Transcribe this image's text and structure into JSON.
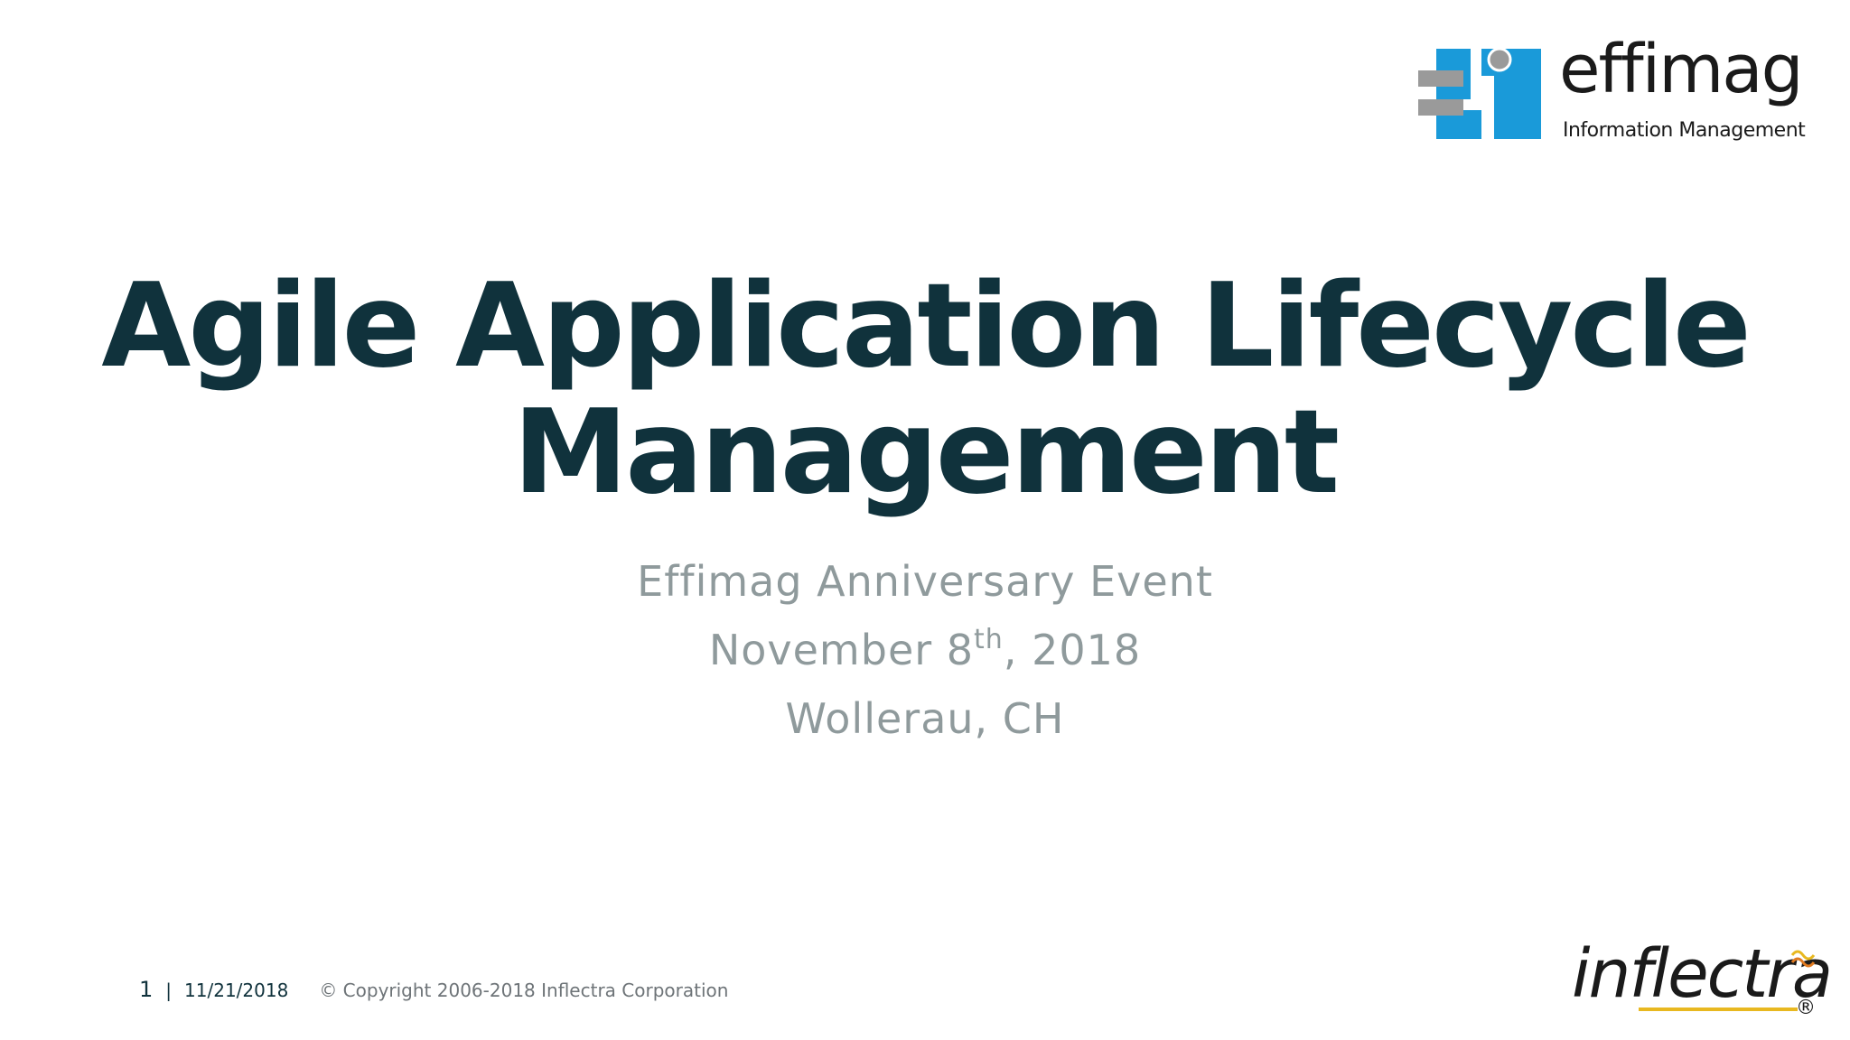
{
  "header": {
    "logo_word": "effimag",
    "logo_tagline": "Information Management",
    "logo_icon": "effimag-logo-icon",
    "colors": {
      "logo_blue": "#1a9ad9",
      "logo_gray": "#9a9a9a"
    }
  },
  "title": {
    "line1": "Agile Application Lifecycle",
    "line2": "Management",
    "color": "#10323c"
  },
  "subtitle": {
    "event": "Effimag Anniversary Event",
    "date_month_day": "November 8",
    "date_suffix": "th",
    "date_year": ", 2018",
    "location": "Wollerau, CH",
    "color": "#8f9a9c"
  },
  "footer": {
    "page_number": "1",
    "separator": "|",
    "date": "11/21/2018",
    "copyright": "© Copyright 2006-2018 Inflectra Corporation"
  },
  "brand": {
    "inflectra_word": "inflectra",
    "registered": "®",
    "accent": "#e8b820"
  }
}
